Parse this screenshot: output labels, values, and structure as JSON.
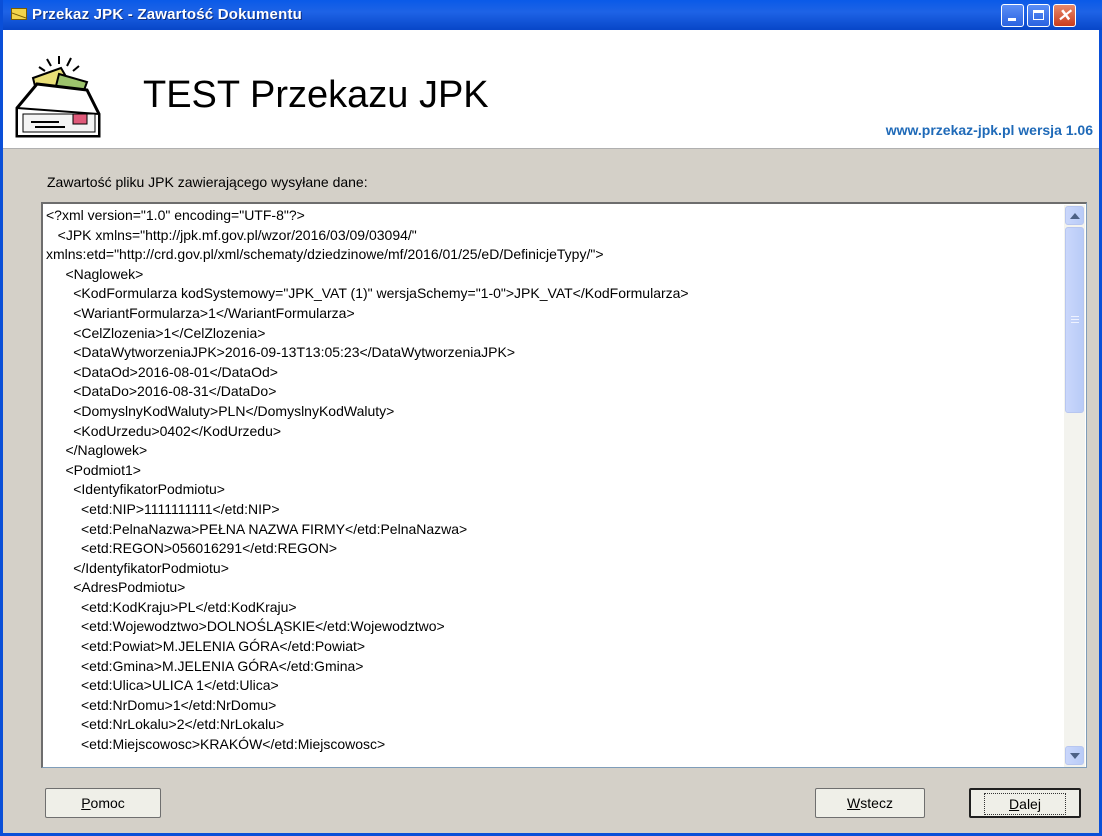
{
  "window": {
    "title": "Przekaz JPK - Zawartość Dokumentu"
  },
  "header": {
    "app_title": "TEST Przekazu JPK",
    "version": "www.przekaz-jpk.pl wersja 1.06"
  },
  "content": {
    "label": "Zawartość pliku JPK zawierającego wysyłane dane:",
    "xml_lines": [
      "<?xml version=\"1.0\" encoding=\"UTF-8\"?>",
      "   <JPK xmlns=\"http://jpk.mf.gov.pl/wzor/2016/03/09/03094/\"",
      "xmlns:etd=\"http://crd.gov.pl/xml/schematy/dziedzinowe/mf/2016/01/25/eD/DefinicjeTypy/\">",
      "     <Naglowek>",
      "       <KodFormularza kodSystemowy=\"JPK_VAT (1)\" wersjaSchemy=\"1-0\">JPK_VAT</KodFormularza>",
      "       <WariantFormularza>1</WariantFormularza>",
      "       <CelZlozenia>1</CelZlozenia>",
      "       <DataWytworzeniaJPK>2016-09-13T13:05:23</DataWytworzeniaJPK>",
      "       <DataOd>2016-08-01</DataOd>",
      "       <DataDo>2016-08-31</DataDo>",
      "       <DomyslnyKodWaluty>PLN</DomyslnyKodWaluty>",
      "       <KodUrzedu>0402</KodUrzedu>",
      "     </Naglowek>",
      "     <Podmiot1>",
      "       <IdentyfikatorPodmiotu>",
      "         <etd:NIP>1111111111</etd:NIP>",
      "         <etd:PelnaNazwa>PEŁNA NAZWA FIRMY</etd:PelnaNazwa>",
      "         <etd:REGON>056016291</etd:REGON>",
      "       </IdentyfikatorPodmiotu>",
      "       <AdresPodmiotu>",
      "         <etd:KodKraju>PL</etd:KodKraju>",
      "         <etd:Wojewodztwo>DOLNOŚLĄSKIE</etd:Wojewodztwo>",
      "         <etd:Powiat>M.JELENIA GÓRA</etd:Powiat>",
      "         <etd:Gmina>M.JELENIA GÓRA</etd:Gmina>",
      "         <etd:Ulica>ULICA 1</etd:Ulica>",
      "         <etd:NrDomu>1</etd:NrDomu>",
      "         <etd:NrLokalu>2</etd:NrLokalu>",
      "         <etd:Miejscowosc>KRAKÓW</etd:Miejscowosc>"
    ]
  },
  "buttons": {
    "help": {
      "mnemonic": "P",
      "rest": "omoc"
    },
    "back": {
      "mnemonic": "W",
      "rest": "stecz"
    },
    "next": {
      "mnemonic": "D",
      "rest": "alej"
    }
  },
  "icons": [
    "envelope-icon",
    "minimize-icon",
    "maximize-icon",
    "close-icon",
    "jpk-logo-icon",
    "scroll-up-icon",
    "scroll-down-icon"
  ]
}
